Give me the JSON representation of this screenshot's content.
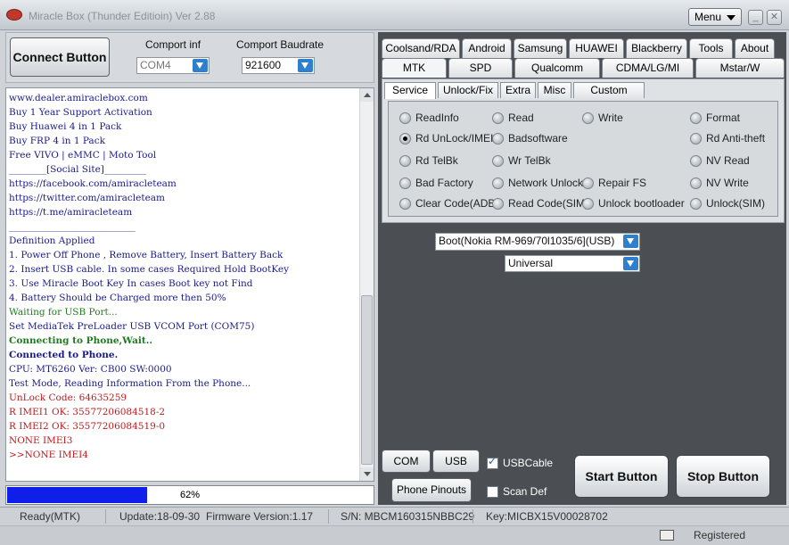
{
  "window": {
    "title": "Miracle Box (Thunder Editioin) Ver 2.88",
    "menu_label": "Menu",
    "minimize": "_",
    "close": "✕"
  },
  "connect": {
    "button_label": "Connect Button",
    "comport_label": "Comport inf",
    "comport_value": "COM4",
    "baudrate_label": "Comport Baudrate",
    "baudrate_value": "921600"
  },
  "log_lines": [
    {
      "text": "www.dealer.amiraclebox.com",
      "style": "c-blue"
    },
    {
      "text": "Buy 1 Year Support Activation",
      "style": "c-blue"
    },
    {
      "text": "Buy Huawei 4 in 1 Pack",
      "style": "c-blue"
    },
    {
      "text": "Buy FRP 4 in 1 Pack",
      "style": "c-blue"
    },
    {
      "text": "Free VIVO | eMMC | Moto Tool",
      "style": "c-blue"
    },
    {
      "text": "________[Social Site]_________",
      "style": "c-blue"
    },
    {
      "text": "https://facebook.com/amiracleteam",
      "style": "c-blue"
    },
    {
      "text": "https://twitter.com/amiracleteam",
      "style": "c-blue"
    },
    {
      "text": "https://t.me/amiracleteam",
      "style": "c-blue"
    },
    {
      "text": "___________________________",
      "style": "c-blue"
    },
    {
      "text": "  Definition Applied",
      "style": "c-blue"
    },
    {
      "text": "  1. Power Off Phone , Remove Battery, Insert Battery Back",
      "style": "c-blue"
    },
    {
      "text": "  2. Insert USB cable. In some cases Required Hold BootKey",
      "style": "c-blue"
    },
    {
      "text": "  3. Use Miracle Boot Key In cases Boot key not Find",
      "style": "c-blue"
    },
    {
      "text": "  4. Battery Should be Charged more then 50%",
      "style": "c-blue"
    },
    {
      "text": "  Waiting for USB Port...",
      "style": "c-green"
    },
    {
      "text": "  Set MediaTek PreLoader USB VCOM Port (COM75)",
      "style": "c-blue"
    },
    {
      "text": "  Connecting to Phone,Wait..",
      "style": "c-green c-bold"
    },
    {
      "text": "  Connected to Phone.",
      "style": "c-blue c-bold"
    },
    {
      "text": "  CPU: MT6260 Ver: CB00  SW:0000",
      "style": "c-blue"
    },
    {
      "text": "  Test Mode, Reading Information From the Phone...",
      "style": "c-blue"
    },
    {
      "text": "  UnLock Code: 64635259",
      "style": "c-red"
    },
    {
      "text": "  R IMEI1 OK: 35577206084518-2",
      "style": "c-red"
    },
    {
      "text": "  R IMEI2 OK: 35577206084519-0",
      "style": "c-red"
    },
    {
      "text": "  NONE IMEI3",
      "style": "c-red"
    },
    {
      "text": ">>NONE IMEI4",
      "style": "c-red"
    }
  ],
  "progress": {
    "value": 62,
    "label": "62%"
  },
  "tabs_row1": [
    "Coolsand/RDA",
    "Android",
    "Samsung",
    "HUAWEI",
    "Blackberry",
    "Tools",
    "About"
  ],
  "tabs_row2": [
    "MTK",
    "SPD",
    "Qualcomm",
    "CDMA/LG/MI",
    "Mstar/W"
  ],
  "subtabs": [
    "Service",
    "Unlock/Fix",
    "Extra",
    "Misc",
    "Custom Setting"
  ],
  "options": {
    "readinfo": "ReadInfo",
    "read": "Read",
    "write": "Write",
    "format": "Format",
    "rd_unlock_imei": "Rd UnLock/IMEI",
    "badsoftware": "Badsoftware",
    "rd_anti_theft": "Rd Anti-theft",
    "rd_telbk": "Rd TelBk",
    "wr_telbk": "Wr TelBk",
    "nv_read": "NV Read",
    "bad_factory": "Bad Factory",
    "network_unlock": "Network Unlock",
    "repair_fs": "Repair FS",
    "nv_write": "NV Write",
    "clear_code_adb": "Clear Code(ADB)",
    "read_code_sim": "Read Code(SIM)",
    "unlock_bootloader": "Unlock bootloader",
    "unlock_sim": "Unlock(SIM)"
  },
  "model_select": "Boot(Nokia RM-969/70l1035/6](USB)",
  "mode_select": "Universal",
  "bottom": {
    "com_scan": "COM Scan",
    "usb_scan": "USB Scan",
    "usbcable": "USBCable",
    "phone_pinouts": "Phone Pinouts",
    "scan_def": "Scan Def",
    "start": "Start Button",
    "stop": "Stop Button"
  },
  "status": {
    "state": "Ready(MTK)",
    "update": "Update:18-09-30",
    "firmware": "Firmware Version:1.17",
    "sn": "S/N: MBCM160315NBBC29",
    "key": "Key:MICBX15V00028702"
  },
  "footer": {
    "registered": "Registered"
  }
}
